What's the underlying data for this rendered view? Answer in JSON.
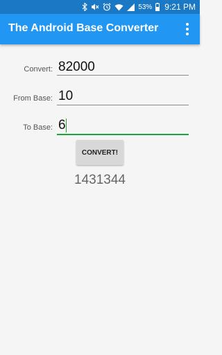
{
  "status_bar": {
    "battery_percent": "53%",
    "time": "9:21 PM",
    "icons": [
      "bluetooth-icon",
      "mute-icon",
      "alarm-icon",
      "wifi-icon",
      "signal-icon",
      "battery-icon"
    ]
  },
  "app_bar": {
    "title": "The Android Base Converter",
    "overflow_icon": "more-vert-icon"
  },
  "form": {
    "convert_label": "Convert:",
    "convert_value": "82000",
    "from_base_label": "From Base:",
    "from_base_value": "10",
    "to_base_label": "To Base:",
    "to_base_value": "6"
  },
  "convert_button_label": "CONVERT!",
  "result": "1431344",
  "colors": {
    "status_bar": "#1a78c4",
    "app_bar": "#2196f3",
    "focus_accent": "#1aa53a",
    "background": "#f5f5f5"
  }
}
